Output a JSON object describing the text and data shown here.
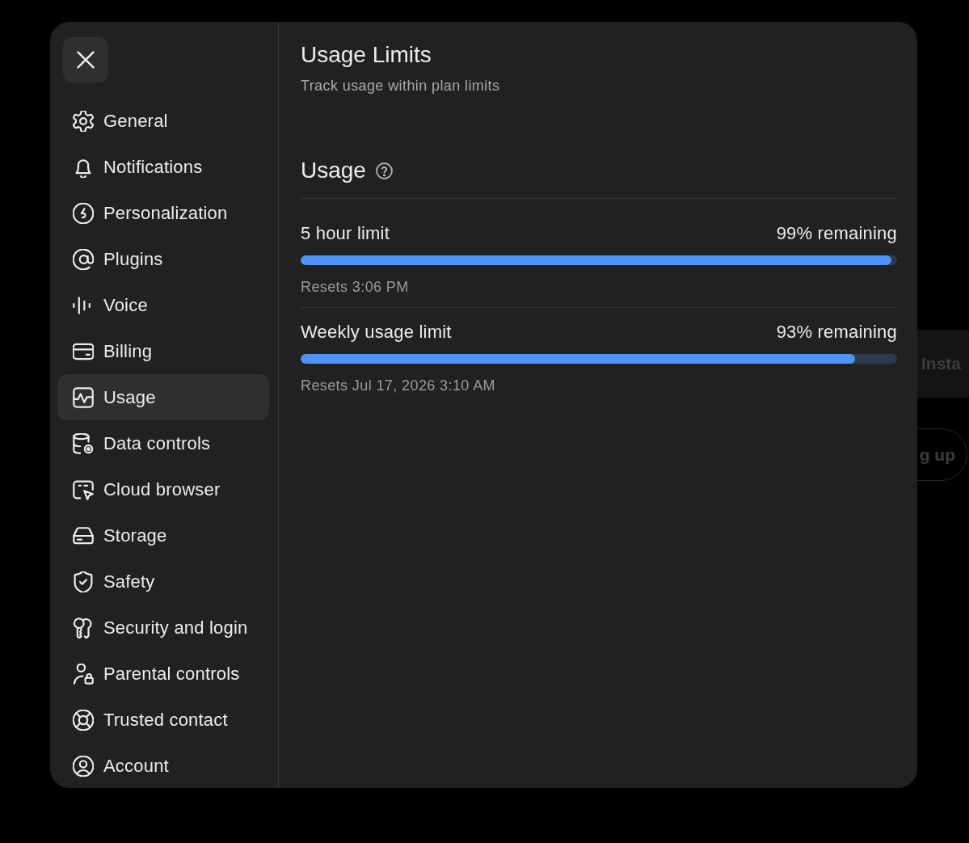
{
  "background": {
    "card_text": "Insta",
    "button_label": "g up"
  },
  "sidebar": {
    "items": [
      {
        "label": "General",
        "selected": false
      },
      {
        "label": "Notifications",
        "selected": false
      },
      {
        "label": "Personalization",
        "selected": false
      },
      {
        "label": "Plugins",
        "selected": false
      },
      {
        "label": "Voice",
        "selected": false
      },
      {
        "label": "Billing",
        "selected": false
      },
      {
        "label": "Usage",
        "selected": true
      },
      {
        "label": "Data controls",
        "selected": false
      },
      {
        "label": "Cloud browser",
        "selected": false
      },
      {
        "label": "Storage",
        "selected": false
      },
      {
        "label": "Safety",
        "selected": false
      },
      {
        "label": "Security and login",
        "selected": false
      },
      {
        "label": "Parental controls",
        "selected": false
      },
      {
        "label": "Trusted contact",
        "selected": false
      },
      {
        "label": "Account",
        "selected": false
      }
    ]
  },
  "content": {
    "title": "Usage Limits",
    "subtitle": "Track usage within plan limits",
    "section": {
      "title": "Usage",
      "limits": [
        {
          "label": "5 hour limit",
          "remaining": "99% remaining",
          "level": 0.99,
          "resets": "Resets 3:06 PM"
        },
        {
          "label": "Weekly usage limit",
          "remaining": "93% remaining",
          "level": 0.93,
          "resets": "Resets Jul 17, 2026 3:10 AM"
        }
      ]
    }
  }
}
